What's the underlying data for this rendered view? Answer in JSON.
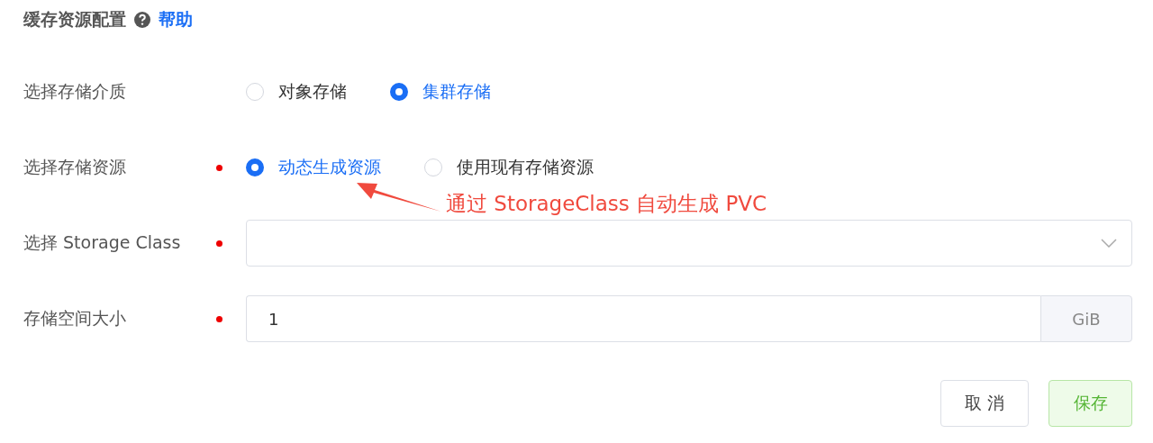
{
  "section": {
    "title": "缓存资源配置",
    "help_link": "帮助"
  },
  "fields": [
    {
      "kind": "radio",
      "label": "选择存储介质",
      "required": false,
      "options": [
        {
          "label": "对象存储",
          "selected": false
        },
        {
          "label": "集群存储",
          "selected": true
        }
      ]
    },
    {
      "kind": "radio",
      "label": "选择存储资源",
      "required": true,
      "options": [
        {
          "label": "动态生成资源",
          "selected": true
        },
        {
          "label": "使用现有存储资源",
          "selected": false
        }
      ]
    },
    {
      "kind": "select",
      "label": "选择 Storage Class",
      "required": true
    },
    {
      "kind": "input",
      "label": "存储空间大小",
      "required": true,
      "value": "1",
      "suffix": "GiB"
    }
  ],
  "annotation": {
    "text": "通过 StorageClass 自动生成 PVC"
  },
  "buttons": [
    {
      "label": "取 消",
      "kind": "default"
    },
    {
      "label": "保存",
      "kind": "primary"
    }
  ]
}
